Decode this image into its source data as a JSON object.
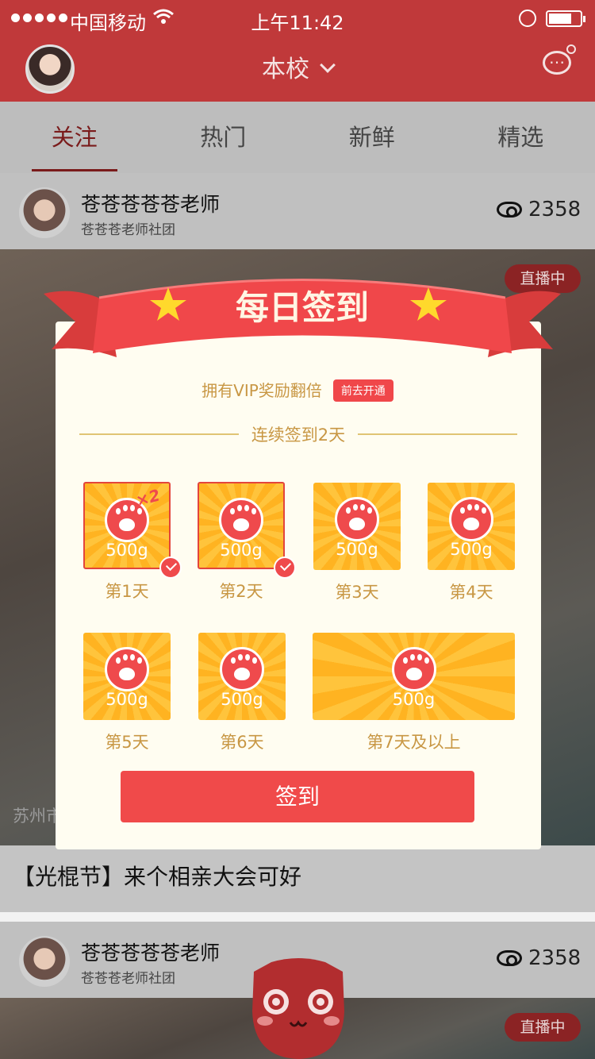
{
  "status_bar": {
    "carrier": "中国移动",
    "time": "上午11:42"
  },
  "header": {
    "title": "本校"
  },
  "tabs": [
    {
      "label": "关注",
      "active": true
    },
    {
      "label": "热门",
      "active": false
    },
    {
      "label": "新鲜",
      "active": false
    },
    {
      "label": "精选",
      "active": false
    }
  ],
  "feed": [
    {
      "author": "苍苍苍苍苍老师",
      "club": "苍苍苍老师社团",
      "views": "2358",
      "badge": "直播中"
    },
    {
      "author": "苍苍苍苍苍老师",
      "club": "苍苍苍老师社团",
      "views": "2358",
      "badge": "直播中"
    }
  ],
  "photo_caption": "苏州市",
  "post_title": "【光棍节】来个相亲大会可好",
  "modal": {
    "title": "每日签到",
    "vip_text": "拥有VIP奖励翻倍",
    "vip_button": "前去开通",
    "streak_text": "连续签到2天",
    "days": [
      {
        "label": "第1天",
        "amount": "500g",
        "checked": true,
        "bonus": "×2"
      },
      {
        "label": "第2天",
        "amount": "500g",
        "checked": true
      },
      {
        "label": "第3天",
        "amount": "500g",
        "checked": false
      },
      {
        "label": "第4天",
        "amount": "500g",
        "checked": false
      },
      {
        "label": "第5天",
        "amount": "500g",
        "checked": false
      },
      {
        "label": "第6天",
        "amount": "500g",
        "checked": false
      },
      {
        "label": "第7天及以上",
        "amount": "500g",
        "checked": false
      }
    ],
    "sign_button": "签到"
  },
  "colors": {
    "brand_red": "#c0393a",
    "accent_red": "#f04a4a",
    "gold": "#ffc43c",
    "label_gold": "#c89744"
  }
}
